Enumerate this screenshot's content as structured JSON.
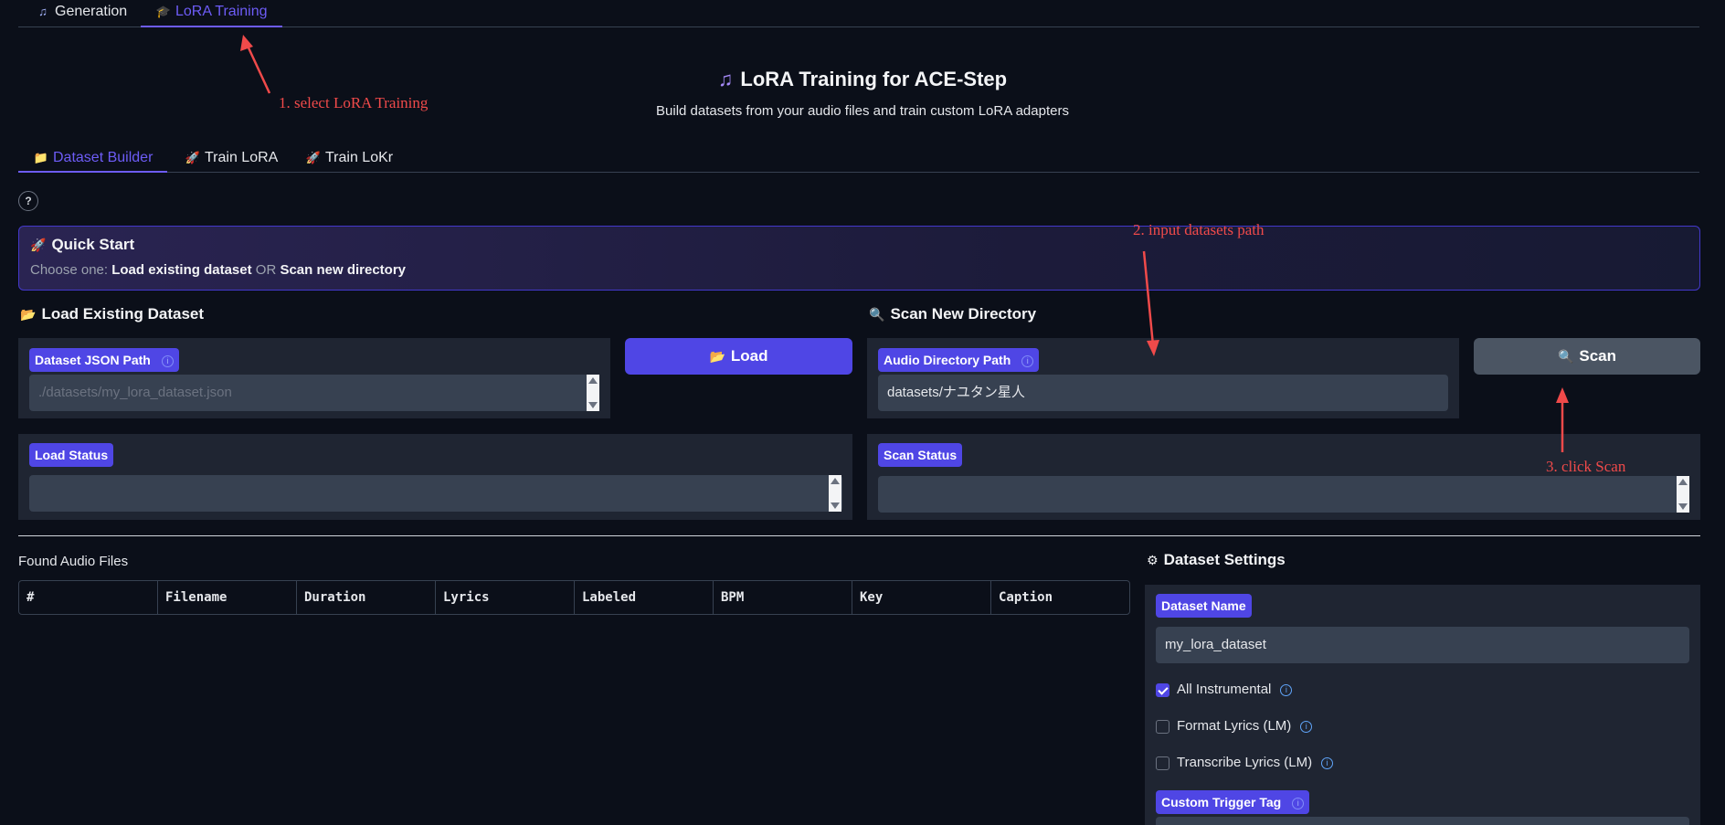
{
  "top_tabs": [
    {
      "label": "Generation",
      "icon": "music-note-icon",
      "glyph": "♫",
      "active": false
    },
    {
      "label": "LoRA Training",
      "icon": "graduation-cap-icon",
      "glyph": "🎓",
      "active": true
    }
  ],
  "header": {
    "title": "LoRA Training for ACE-Step",
    "subtitle": "Build datasets from your audio files and train custom LoRA adapters"
  },
  "sub_tabs": [
    {
      "label": "Dataset Builder",
      "icon": "folder-icon",
      "glyph": "📁",
      "active": true
    },
    {
      "label": "Train LoRA",
      "icon": "rocket-icon",
      "glyph": "🚀",
      "active": false
    },
    {
      "label": "Train LoKr",
      "icon": "rocket-icon",
      "glyph": "🚀",
      "active": false
    }
  ],
  "help_label": "?",
  "quick_start": {
    "title": "Quick Start",
    "prefix": "Choose one: ",
    "option_a": "Load existing dataset",
    "or": " OR ",
    "option_b": "Scan new directory"
  },
  "load_existing": {
    "heading": "Load Existing Dataset",
    "json_path_label": "Dataset JSON Path",
    "json_path_placeholder": "./datasets/my_lora_dataset.json",
    "load_button": "Load",
    "status_label": "Load Status",
    "status_value": ""
  },
  "scan_new": {
    "heading": "Scan New Directory",
    "dir_label": "Audio Directory Path",
    "dir_value": "datasets/ナユタン星人",
    "scan_button": "Scan",
    "status_label": "Scan Status",
    "status_value": ""
  },
  "found_files": {
    "label": "Found Audio Files",
    "columns": [
      "#",
      "Filename",
      "Duration",
      "Lyrics",
      "Labeled",
      "BPM",
      "Key",
      "Caption"
    ]
  },
  "dataset_settings": {
    "heading": "Dataset Settings",
    "name_label": "Dataset Name",
    "name_value": "my_lora_dataset",
    "checkboxes": [
      {
        "label": "All Instrumental",
        "checked": true
      },
      {
        "label": "Format Lyrics (LM)",
        "checked": false
      },
      {
        "label": "Transcribe Lyrics (LM)",
        "checked": false
      }
    ],
    "trigger_label": "Custom Trigger Tag"
  },
  "annotations": {
    "step1": "1. select LoRA Training",
    "step2": "2. input datasets path",
    "step3": "3. click Scan",
    "color": "#f04a4a"
  },
  "colors": {
    "accent": "#4f46e5",
    "background": "#0b0f19",
    "panel": "#1f2532"
  }
}
